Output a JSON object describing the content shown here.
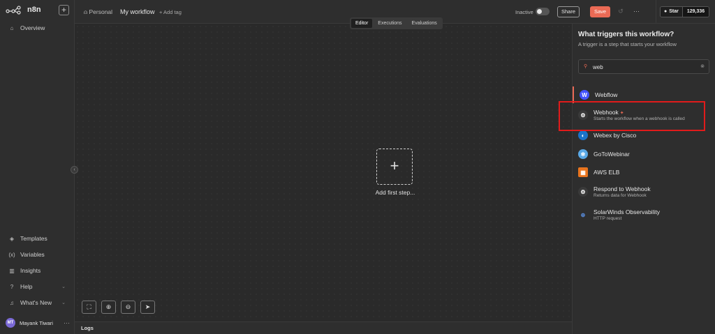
{
  "app": {
    "logo_text": "n8n"
  },
  "sidebar": {
    "items": [
      {
        "label": "Overview",
        "icon": "home-icon"
      },
      {
        "label": "Templates",
        "icon": "templates-icon"
      },
      {
        "label": "Variables",
        "icon": "variables-icon"
      },
      {
        "label": "Insights",
        "icon": "insights-icon"
      },
      {
        "label": "Help",
        "icon": "help-icon"
      },
      {
        "label": "What's New",
        "icon": "bell-icon"
      }
    ],
    "user": {
      "initials": "MT",
      "name": "Mayank Tiwari"
    }
  },
  "header": {
    "project": "Personal",
    "workflow_title": "My workflow",
    "add_tag": "+ Add tag",
    "status_label": "Inactive",
    "share_label": "Share",
    "save_label": "Save",
    "github": {
      "star_label": "Star",
      "count": "129,336"
    }
  },
  "canvas": {
    "tabs": [
      "Editor",
      "Executions",
      "Evaluations"
    ],
    "active_tab": "Editor",
    "add_first_step": "Add first step...",
    "logs_label": "Logs"
  },
  "panel": {
    "title": "What triggers this workflow?",
    "subtitle": "A trigger is a step that starts your workflow",
    "search_value": "web",
    "results": [
      {
        "name": "Webflow",
        "desc": "",
        "icon_color": "#4353ff",
        "icon_letter": "W"
      },
      {
        "name": "Webhook",
        "desc": "Starts the workflow when a webhook is called",
        "icon_color": "#3a3a3a",
        "icon_letter": ""
      },
      {
        "name": "Webex by Cisco",
        "desc": "",
        "icon_color": "#1a73c9",
        "icon_letter": ""
      },
      {
        "name": "GoToWebinar",
        "desc": "",
        "icon_color": "#5aa9e6",
        "icon_letter": ""
      },
      {
        "name": "AWS ELB",
        "desc": "",
        "icon_color": "#e8741e",
        "icon_letter": ""
      },
      {
        "name": "Respond to Webhook",
        "desc": "Returns data for Webhook",
        "icon_color": "#3a3a3a",
        "icon_letter": ""
      },
      {
        "name": "SolarWinds Observability",
        "desc": "HTTP request",
        "icon_color": "#2e2e2e",
        "icon_letter": ""
      }
    ]
  }
}
